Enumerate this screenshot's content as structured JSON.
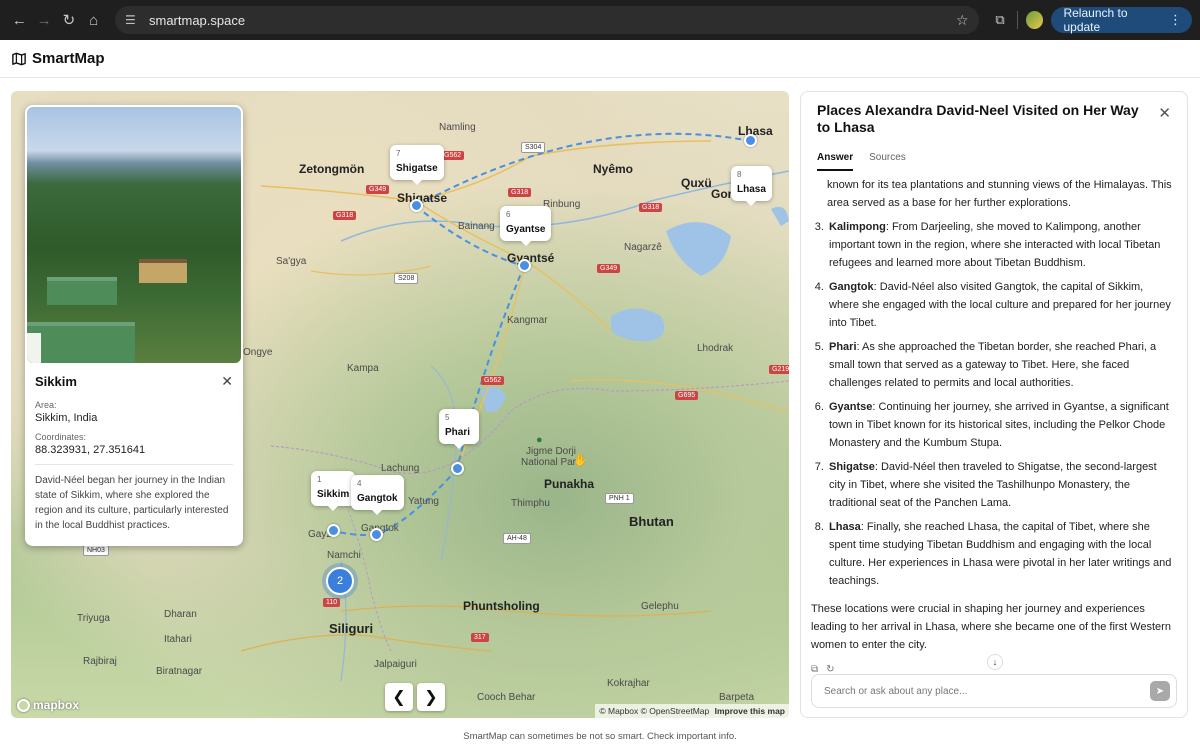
{
  "browser": {
    "url": "smartmap.space",
    "relaunch_label": "Relaunch to update"
  },
  "app": {
    "title": "SmartMap"
  },
  "map": {
    "places": [
      {
        "label": "Namling"
      },
      {
        "label": "Zetongmön"
      },
      {
        "label": "Nyêmo"
      },
      {
        "label": "Lhasa"
      },
      {
        "label": "Shigatse"
      },
      {
        "label": "Rinbung"
      },
      {
        "label": "Quxü"
      },
      {
        "label": "Gon"
      },
      {
        "label": "Bainang"
      },
      {
        "label": "Gyantsé"
      },
      {
        "label": "Nagarzê"
      },
      {
        "label": "Sa'gya"
      },
      {
        "label": "Kangmar"
      },
      {
        "label": "Lhodrak"
      },
      {
        "label": "Kampa"
      },
      {
        "label": "Jigme Dorji National Park"
      },
      {
        "label": "Lachung"
      },
      {
        "label": "Yatung"
      },
      {
        "label": "Punakha"
      },
      {
        "label": "Thimphu"
      },
      {
        "label": "Gayzi"
      },
      {
        "label": "Gangtok"
      },
      {
        "label": "Namchi"
      },
      {
        "label": "Bhutan"
      },
      {
        "label": "Phuntsholing"
      },
      {
        "label": "Siliguri"
      },
      {
        "label": "Dharan"
      },
      {
        "label": "Triyuga"
      },
      {
        "label": "Itahari"
      },
      {
        "label": "Rajbiraj"
      },
      {
        "label": "Biratnagar"
      },
      {
        "label": "Jalpaiguri"
      },
      {
        "label": "Cooch Behar"
      },
      {
        "label": "Kokrajhar"
      },
      {
        "label": "Barpeta"
      },
      {
        "label": "Gelephu"
      },
      {
        "label": "Ongye"
      }
    ],
    "roads": [
      "S304",
      "G562",
      "G349",
      "G318",
      "G318",
      "S208",
      "G349",
      "G562",
      "G695",
      "PNH 1",
      "AH-48",
      "NH03",
      "110",
      "317",
      "G219"
    ],
    "pins": [
      {
        "num": "7",
        "name": "Shigatse"
      },
      {
        "num": "6",
        "name": "Gyantse"
      },
      {
        "num": "8",
        "name": "Lhasa"
      },
      {
        "num": "5",
        "name": "Phari"
      },
      {
        "num": "1",
        "name": "Sikkim"
      },
      {
        "num": "4",
        "name": "Gangtok"
      }
    ],
    "cluster_count": "2",
    "prev_label": "❮",
    "next_label": "❯",
    "logo_text": "mapbox",
    "attribution": "© Mapbox © OpenStreetMap",
    "improve": "Improve this map"
  },
  "popup": {
    "title": "Sikkim",
    "area_label": "Area:",
    "area_value": "Sikkim, India",
    "coords_label": "Coordinates:",
    "coords_value": "88.323931, 27.351641",
    "description": "David-Néel began her journey in the Indian state of Sikkim, where she explored the region and its culture, particularly interested in the local Buddhist practices."
  },
  "panel": {
    "title": "Places Alexandra David-Neel Visited on Her Way to Lhasa",
    "tabs": [
      {
        "label": "Answer"
      },
      {
        "label": "Sources"
      }
    ],
    "continued_text": "known for its tea plantations and stunning views of the Himalayas. This area served as a base for her further explorations.",
    "items": [
      {
        "lead": "Kalimpong",
        "text": ": From Darjeeling, she moved to Kalimpong, another important town in the region, where she interacted with local Tibetan refugees and learned more about Tibetan Buddhism."
      },
      {
        "lead": "Gangtok",
        "text": ": David-Néel also visited Gangtok, the capital of Sikkim, where she engaged with the local culture and prepared for her journey into Tibet."
      },
      {
        "lead": "Phari",
        "text": ": As she approached the Tibetan border, she reached Phari, a small town that served as a gateway to Tibet. Here, she faced challenges related to permits and local authorities."
      },
      {
        "lead": "Gyantse",
        "text": ": Continuing her journey, she arrived in Gyantse, a significant town in Tibet known for its historical sites, including the Pelkor Chode Monastery and the Kumbum Stupa."
      },
      {
        "lead": "Shigatse",
        "text": ": David-Néel then traveled to Shigatse, the second-largest city in Tibet, where she visited the Tashilhunpo Monastery, the traditional seat of the Panchen Lama."
      },
      {
        "lead": "Lhasa",
        "text": ": Finally, she reached Lhasa, the capital of Tibet, where she spent time studying Tibetan Buddhism and engaging with the local culture. Her experiences in Lhasa were pivotal in her later writings and teachings."
      }
    ],
    "outro": "These locations were crucial in shaping her journey and experiences leading to her arrival in Lhasa, where she became one of the first Western women to enter the city.",
    "search_placeholder": "Search or ask about any place..."
  },
  "footer": {
    "note": "SmartMap can sometimes be not so smart. Check important info."
  },
  "colors": {
    "accent": "#3b7fdc",
    "route": "#4a8fe0",
    "relaunch_bg": "#1e4b7a"
  },
  "icons": [
    "back-icon",
    "forward-icon",
    "reload-icon",
    "home-icon",
    "site-info-icon",
    "star-icon",
    "extensions-icon",
    "menu-dots-icon",
    "map-icon",
    "close-icon",
    "copy-icon",
    "regenerate-icon",
    "arrow-down-icon",
    "send-icon",
    "mapbox-icon",
    "park-icon",
    "hand-cursor-icon"
  ]
}
